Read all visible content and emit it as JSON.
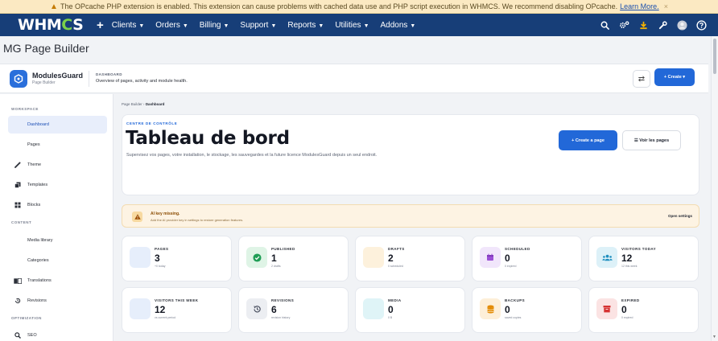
{
  "warning": {
    "text": "The OPcache PHP extension is enabled. This extension can cause problems with cached data use and PHP script execution in WHMCS. We recommend disabling OPcache.",
    "link": "Learn More.",
    "close": "×"
  },
  "nav": {
    "logo_a": "WHM",
    "logo_o": "C",
    "logo_b": "S",
    "plus": "+",
    "menu": [
      {
        "label": "Clients"
      },
      {
        "label": "Orders"
      },
      {
        "label": "Billing"
      },
      {
        "label": "Support"
      },
      {
        "label": "Reports"
      },
      {
        "label": "Utilities"
      },
      {
        "label": "Addons"
      }
    ]
  },
  "page_title": "MG Page Builder",
  "header": {
    "brand": "ModulesGuard",
    "brand_sub": "Page Builder",
    "kicker": "DASHBOARD",
    "description": "Overview of pages, activity and module health.",
    "create_label": "+ Create ▾"
  },
  "sidebar": {
    "sections": {
      "workspace": "WORKSPACE",
      "content": "CONTENT",
      "optimization": "OPTIMIZATION"
    },
    "items": [
      {
        "label": "Dashboard"
      },
      {
        "label": "Pages"
      },
      {
        "label": "Theme"
      },
      {
        "label": "Templates"
      },
      {
        "label": "Blocks"
      },
      {
        "label": "Media library"
      },
      {
        "label": "Categories"
      },
      {
        "label": "Translations"
      },
      {
        "label": "Revisions"
      },
      {
        "label": "SEO"
      }
    ]
  },
  "breadcrumb": {
    "root": "Page Builder",
    "sep": "›",
    "current": "Dashboard"
  },
  "hero": {
    "kicker": "CENTRE DE CONTRÔLE",
    "title": "Tableau de bord",
    "description": "Supervisez vos pages, votre installation, le stockage, les sauvegardes et la future licence ModulesGuard depuis un seul endroit.",
    "primary_btn": "+ Create a page",
    "secondary_btn": "☰ Voir les pages"
  },
  "alert": {
    "title": "AI key missing.",
    "subtitle": "Add the AI provider key in settings to restore generation features.",
    "link": "Open settings"
  },
  "stats": [
    {
      "label": "PAGES",
      "value": "3",
      "sub": "+0 today",
      "icon": "page-icon",
      "bg": "#e6eefb",
      "fg": "#2268d8"
    },
    {
      "label": "PUBLISHED",
      "value": "1",
      "sub": "2 drafts",
      "icon": "check-icon",
      "bg": "#dff4e6",
      "fg": "#1f9d55"
    },
    {
      "label": "DRAFTS",
      "value": "2",
      "sub": "0 scheduled",
      "icon": "draft-icon",
      "bg": "#fdf1dc",
      "fg": "#d58a12"
    },
    {
      "label": "SCHEDULED",
      "value": "0",
      "sub": "0 expired",
      "icon": "calendar-icon",
      "bg": "#f1e6fb",
      "fg": "#9b4fd6"
    },
    {
      "label": "VISITORS TODAY",
      "value": "12",
      "sub": "12 this week",
      "icon": "users-icon",
      "bg": "#ddf1f8",
      "fg": "#1f8fbf"
    },
    {
      "label": "VISITORS THIS WEEK",
      "value": "12",
      "sub": "vs current period",
      "icon": "chart-icon",
      "bg": "#e6eefb",
      "fg": "#2268d8"
    },
    {
      "label": "REVISIONS",
      "value": "6",
      "sub": "revision history",
      "icon": "history-icon",
      "bg": "#eceef2",
      "fg": "#4a5060"
    },
    {
      "label": "MEDIA",
      "value": "0",
      "sub": "0 B",
      "icon": "image-icon",
      "bg": "#dff4f7",
      "fg": "#1fa4b8"
    },
    {
      "label": "BACKUPS",
      "value": "0",
      "sub": "saved copies",
      "icon": "database-icon",
      "bg": "#fdefd8",
      "fg": "#e38a00"
    },
    {
      "label": "EXPIRED",
      "value": "0",
      "sub": "0 expired",
      "icon": "archive-icon",
      "bg": "#fbe3e3",
      "fg": "#d63232"
    }
  ],
  "colors": {
    "nav_bg": "#173e78",
    "primary": "#2268d8",
    "logo_accent": "#7ad14a"
  }
}
